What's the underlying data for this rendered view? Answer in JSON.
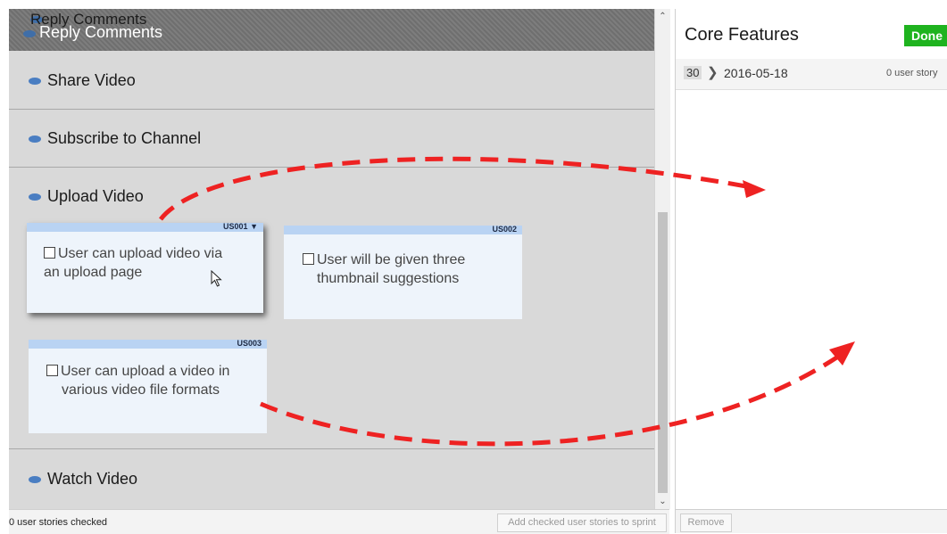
{
  "backlog": {
    "header_ghost": "Reply Comments",
    "header_title": "Reply Comments",
    "sections": [
      {
        "label": "Share Video"
      },
      {
        "label": "Subscribe to Channel"
      },
      {
        "label": "Upload Video"
      },
      {
        "label": "Watch Video"
      }
    ],
    "cards": [
      {
        "id": "US001",
        "text_line1": "User can upload video via",
        "text_line2": "an upload page"
      },
      {
        "id": "US002",
        "text_line1": "User will be given three",
        "text_line2": "thumbnail suggestions"
      },
      {
        "id": "US003",
        "text_line1": "User can upload a video in",
        "text_line2": "various video file formats"
      }
    ],
    "status": "0 user stories checked",
    "add_button": "Add checked user stories to sprint"
  },
  "sprint": {
    "title": "Core Features",
    "status_badge": "Done",
    "number": "30",
    "date": "2016-05-18",
    "story_count": "0 user story",
    "remove_button": "Remove"
  },
  "colors": {
    "arrow": "#ee2222",
    "done_badge": "#1fb31f",
    "card_header": "#b9d3f3",
    "bullet": "#4a7ec2"
  }
}
